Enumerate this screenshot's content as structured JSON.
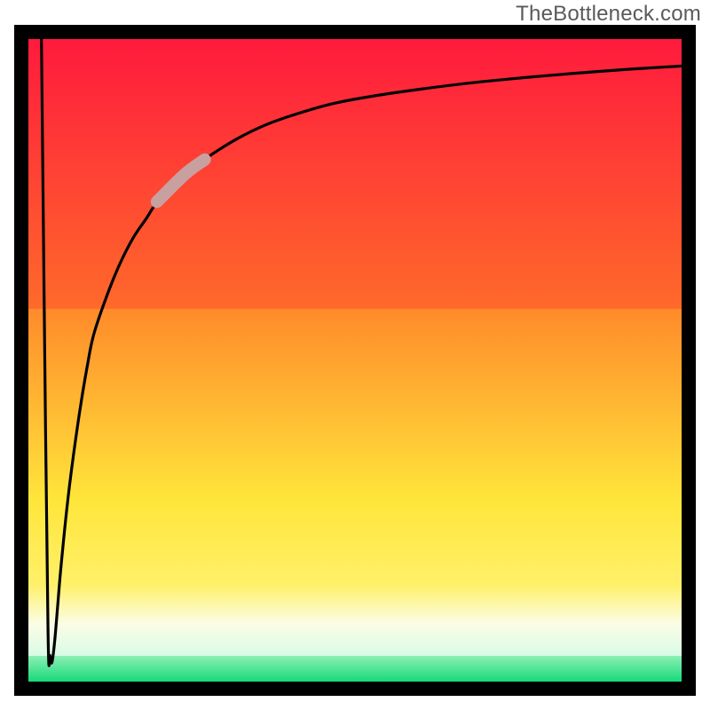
{
  "watermark": "TheBottleneck.com",
  "chart_data": {
    "type": "line",
    "title": "",
    "xlabel": "",
    "ylabel": "",
    "xlim": [
      0,
      100
    ],
    "ylim": [
      0,
      100
    ],
    "grid": false,
    "legend": false,
    "annotations": [
      {
        "text": "TheBottleneck.com",
        "position": "top-right"
      }
    ],
    "gradient_stops": [
      {
        "pct": 0,
        "color": "#ff1a3d"
      },
      {
        "pct": 42,
        "color": "#ff8a2a"
      },
      {
        "pct": 72,
        "color": "#ffe63b"
      },
      {
        "pct": 91,
        "color": "#fbfde6"
      },
      {
        "pct": 100,
        "color": "#17d97a"
      }
    ],
    "highlight_segment": {
      "x_start": 20,
      "x_end": 27
    },
    "series": [
      {
        "name": "curve",
        "x": [
          2.0,
          2.4,
          3.0,
          3.3,
          3.6,
          4.0,
          4.5,
          5.0,
          6.0,
          7.0,
          8.0,
          9.0,
          10,
          12,
          14,
          16,
          18,
          20,
          24,
          28,
          32,
          36,
          40,
          46,
          52,
          60,
          68,
          76,
          84,
          92,
          100
        ],
        "y": [
          100,
          60,
          8,
          4,
          3,
          6,
          12,
          18,
          28,
          36,
          43,
          49,
          54,
          60,
          65,
          69,
          72,
          75,
          79,
          82,
          84.5,
          86.5,
          88,
          89.8,
          91,
          92.2,
          93.2,
          94,
          94.7,
          95.3,
          95.8
        ]
      }
    ]
  }
}
